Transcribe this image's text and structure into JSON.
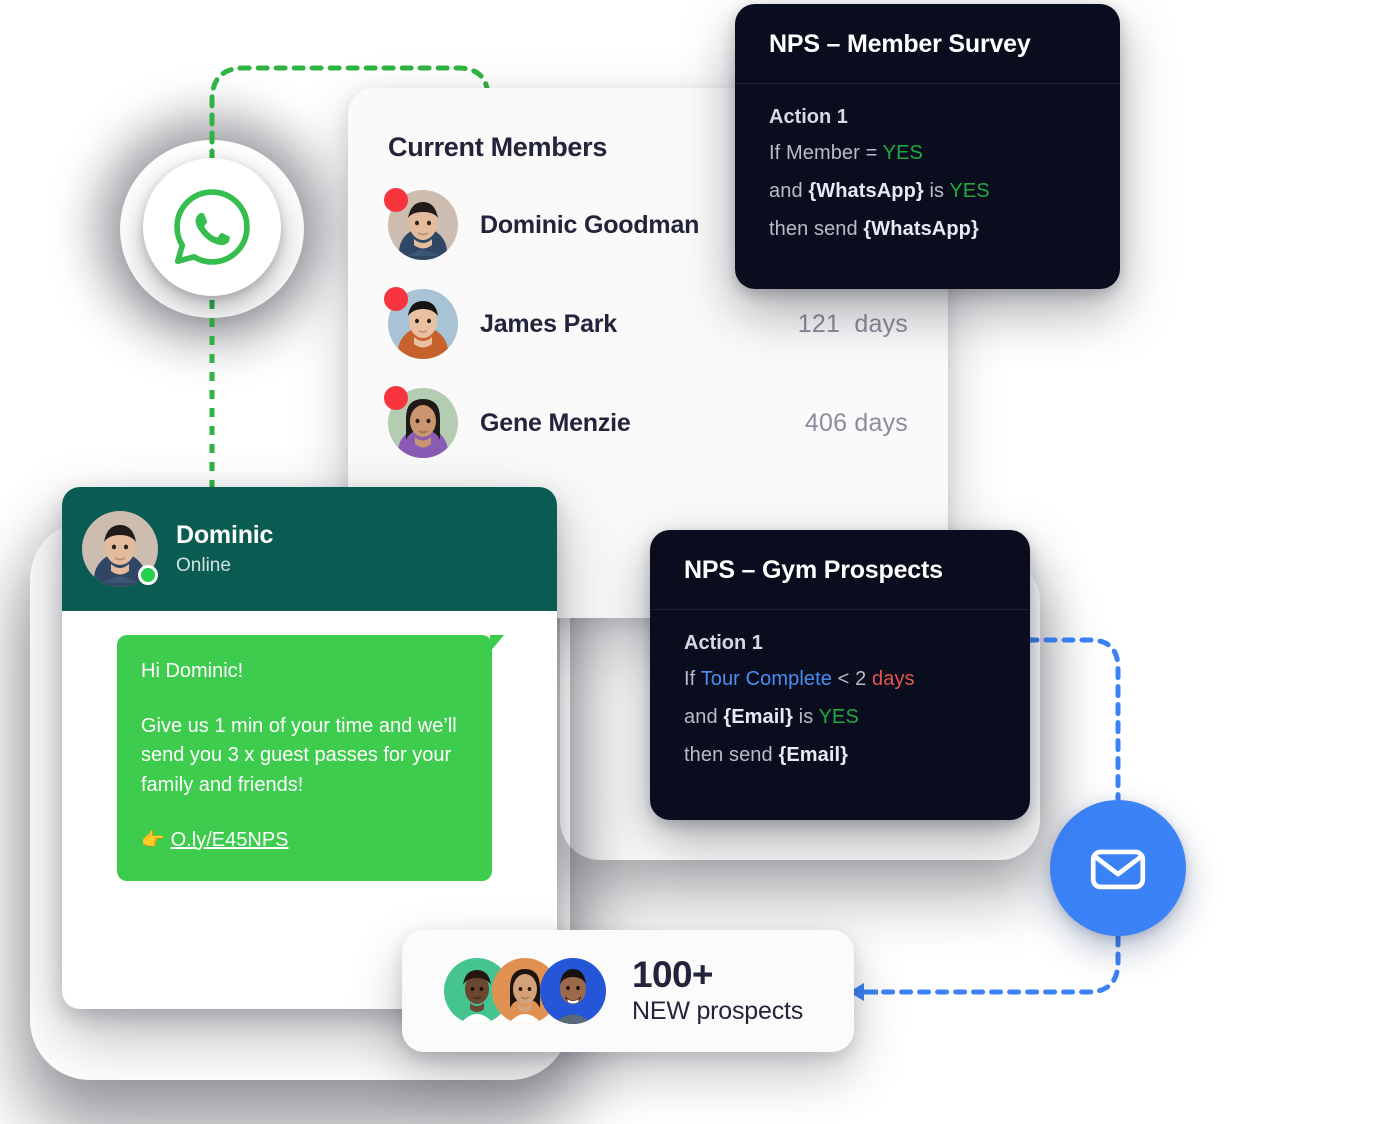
{
  "colors": {
    "dark_card_bg": "#090d1e",
    "whatsapp_green": "#3ecc4f",
    "whatsapp_header_teal": "#0a5b52",
    "email_blue": "#3b82f6",
    "yes_green": "#1faa40",
    "token_blue": "#4a8ef0",
    "token_red": "#e2574c",
    "badge_red": "#f8343f",
    "text_dark": "#23243c",
    "text_muted": "#8b8d9b"
  },
  "channel_icons": {
    "whatsapp": {
      "name": "whatsapp-icon"
    },
    "email": {
      "name": "email-icon"
    }
  },
  "members_card": {
    "title": "Current Members",
    "rows": [
      {
        "name": "Dominic Goodman",
        "days": "",
        "status": "alert"
      },
      {
        "name": "James Park",
        "days": "121  days",
        "status": "alert"
      },
      {
        "name": "Gene Menzie",
        "days": "406 days",
        "status": "alert"
      }
    ]
  },
  "nps_member_survey": {
    "title": "NPS – Member Survey",
    "action_label": "Action 1",
    "lines": [
      {
        "pre": "If Member = ",
        "token": "YES",
        "token_style": "yes",
        "post": ""
      },
      {
        "pre": "and ",
        "bold": "{WhatsApp}",
        "mid": " is ",
        "token": "YES",
        "token_style": "yes"
      },
      {
        "pre": "then send ",
        "bold": "{WhatsApp}"
      }
    ],
    "line1_text": "If Member = YES",
    "line2_text": "and {WhatsApp} is YES",
    "line3_text": "then send {WhatsApp}"
  },
  "nps_gym_prospects": {
    "title": "NPS – Gym Prospects",
    "action_label": "Action 1",
    "line1_if": "If",
    "line1_field": "Tour Complete",
    "line1_op": "<",
    "line1_value": "2",
    "line1_unit": "days",
    "line2_pre": "and",
    "line2_field": "{Email}",
    "line2_mid": "is",
    "line2_value": "YES",
    "line3_pre": "then send",
    "line3_field": "{Email}"
  },
  "chat": {
    "contact_name": "Dominic",
    "status": "Online",
    "message": {
      "greeting": "Hi Dominic!",
      "body": "Give us 1 min of your time and we’ll send you 3 x guest passes for your family and friends!",
      "emoji": "👉",
      "link": "O.ly/E45NPS"
    }
  },
  "prospects": {
    "count": "100+",
    "label": "NEW prospects",
    "avatar_count": 3
  }
}
